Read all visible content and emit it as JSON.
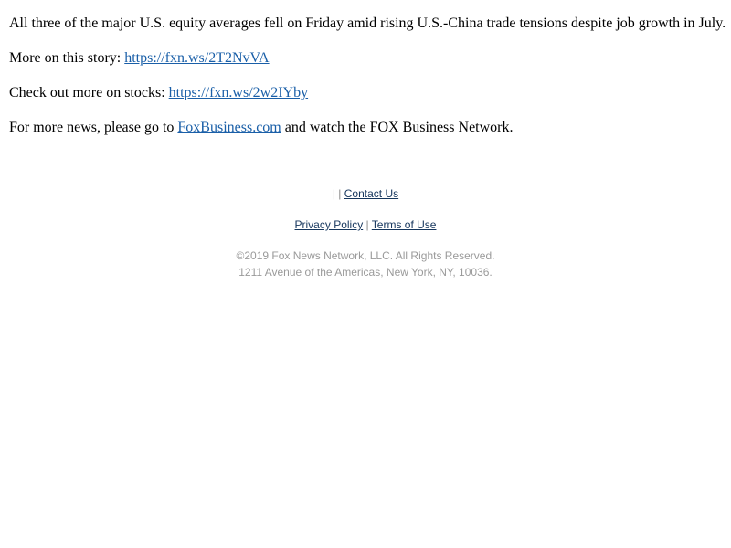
{
  "article": {
    "para1": "All three of the major U.S. equity averages fell on Friday amid rising U.S.-China trade tensions despite job growth in July.",
    "para2_prefix": "More on this story: ",
    "para2_link": "https://fxn.ws/2T2NvVA",
    "para3_prefix": "Check out more on stocks: ",
    "para3_link": "https://fxn.ws/2w2IYby",
    "para4_prefix": "For more news, please go to ",
    "para4_link": "FoxBusiness.com",
    "para4_suffix": " and watch the FOX Business Network."
  },
  "footer": {
    "top_separators": "| | ",
    "contact_label": "Contact Us",
    "privacy_label": "Privacy Policy",
    "middle_separator": " | ",
    "terms_label": "Terms of Use",
    "copyright": "©2019 Fox News Network, LLC. All Rights Reserved.",
    "address": "1211 Avenue of the Americas, New York, NY, 10036."
  },
  "colors": {
    "body_link": "#1a5fa8",
    "footer_link": "#16365d",
    "muted_text": "#9a9a9a"
  }
}
